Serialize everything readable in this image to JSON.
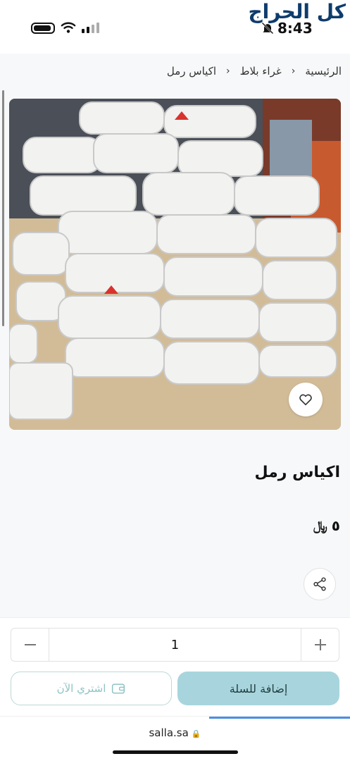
{
  "status_bar": {
    "time": "8:43",
    "store_name": "كل الحراج"
  },
  "breadcrumb": {
    "home": "الرئيسية",
    "category": "غراء بلاط",
    "current": "اكياس رمل"
  },
  "product": {
    "title": "اكياس رمل",
    "price": "٥",
    "currency_symbol": "﷼",
    "image_alt": "اكياس رمل"
  },
  "cart": {
    "quantity": "1",
    "add_to_cart_label": "إضافة للسلة",
    "buy_now_label": "اشتري الآن"
  },
  "browser": {
    "url": "salla.sa"
  },
  "colors": {
    "add_to_cart_bg": "#a8d5dd",
    "buy_now_text": "#8fc3c3",
    "logo": "#0e3c6c"
  }
}
